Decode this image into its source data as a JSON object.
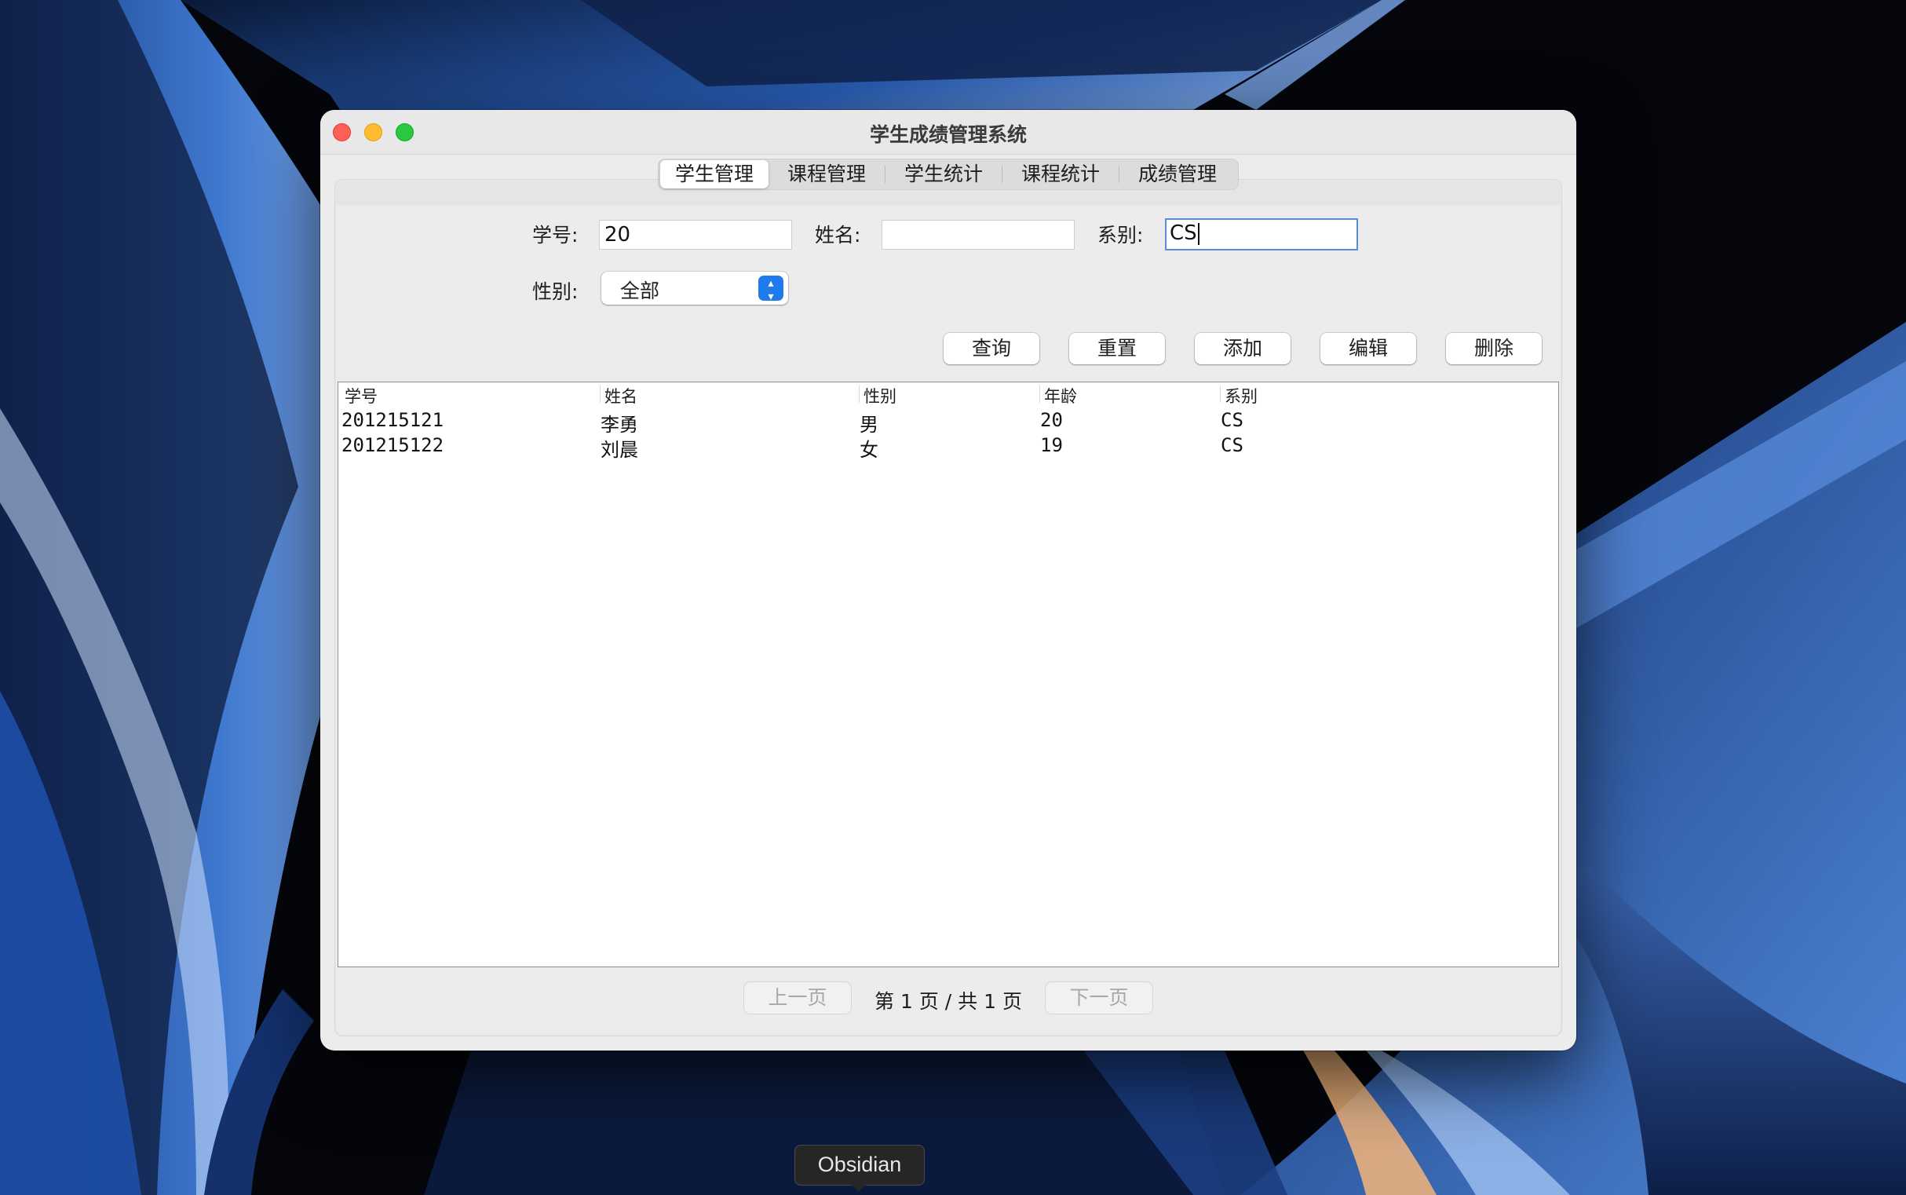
{
  "window": {
    "title": "学生成绩管理系统"
  },
  "tabs": [
    {
      "label": "学生管理",
      "active": true
    },
    {
      "label": "课程管理",
      "active": false
    },
    {
      "label": "学生统计",
      "active": false
    },
    {
      "label": "课程统计",
      "active": false
    },
    {
      "label": "成绩管理",
      "active": false
    }
  ],
  "form": {
    "student_id_label": "学号:",
    "student_id_value": "20",
    "name_label": "姓名:",
    "name_value": "",
    "dept_label": "系别:",
    "dept_value": "CS",
    "gender_label": "性别:",
    "gender_value": "全部"
  },
  "buttons": {
    "query": "查询",
    "reset": "重置",
    "add": "添加",
    "edit": "编辑",
    "delete": "删除"
  },
  "table": {
    "columns": [
      "学号",
      "姓名",
      "性别",
      "年龄",
      "系别"
    ],
    "rows": [
      [
        "201215121",
        "李勇",
        "男",
        "20",
        "CS"
      ],
      [
        "201215122",
        "刘晨",
        "女",
        "19",
        "CS"
      ]
    ]
  },
  "pagination": {
    "prev": "上一页",
    "next": "下一页",
    "info": "第 1 页 / 共 1 页"
  },
  "dock": {
    "tooltip": "Obsidian"
  }
}
